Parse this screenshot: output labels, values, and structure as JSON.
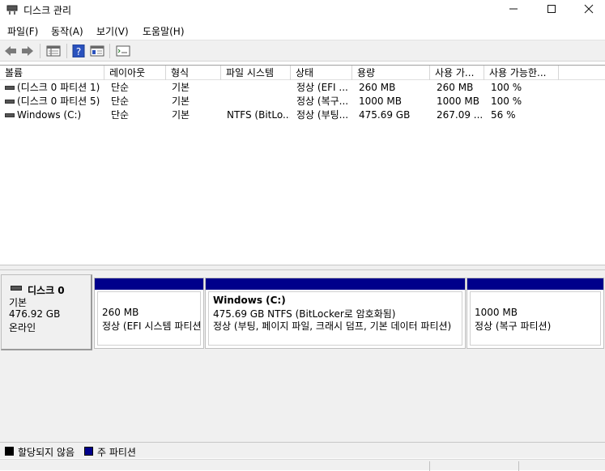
{
  "window": {
    "title": "디스크 관리",
    "minimize": "—",
    "maximize": "☐",
    "close": "✕"
  },
  "menu": [
    "파일(F)",
    "동작(A)",
    "보기(V)",
    "도움말(H)"
  ],
  "toolbar": {
    "icons": [
      "back-arrow-icon",
      "forward-arrow-icon",
      "list-view-icon",
      "help-icon",
      "properties-icon",
      "console-icon"
    ]
  },
  "volume_list": {
    "columns": [
      "볼륨",
      "레이아웃",
      "형식",
      "파일 시스템",
      "상태",
      "용량",
      "사용 가...",
      "사용 가능한..."
    ],
    "rows": [
      [
        "(디스크 0 파티션 1)",
        "단순",
        "기본",
        "",
        "정상 (EFI ...",
        "260 MB",
        "260 MB",
        "100 %"
      ],
      [
        "(디스크 0 파티션 5)",
        "단순",
        "기본",
        "",
        "정상 (복구...",
        "1000 MB",
        "1000 MB",
        "100 %"
      ],
      [
        "Windows (C:)",
        "단순",
        "기본",
        "NTFS (BitLo...",
        "정상 (부팅...",
        "475.69 GB",
        "267.09 ...",
        "56 %"
      ]
    ]
  },
  "disk": {
    "name": "디스크 0",
    "type": "기본",
    "size": "476.92 GB",
    "status": "온라인"
  },
  "partitions": [
    {
      "title": "",
      "size": "260 MB",
      "status": "정상 (EFI 시스템 파티션)"
    },
    {
      "title": "Windows  (C:)",
      "size": "475.69 GB NTFS (BitLocker로 암호화됨)",
      "status": "정상 (부팅, 페이지 파일, 크래시 덤프, 기본 데이터 파티션)"
    },
    {
      "title": "",
      "size": "1000 MB",
      "status": "정상 (복구 파티션)"
    }
  ],
  "legend": {
    "unallocated": "할당되지 않음",
    "primary": "주 파티션",
    "unallocated_color": "#000000",
    "primary_color": "#00008b"
  }
}
